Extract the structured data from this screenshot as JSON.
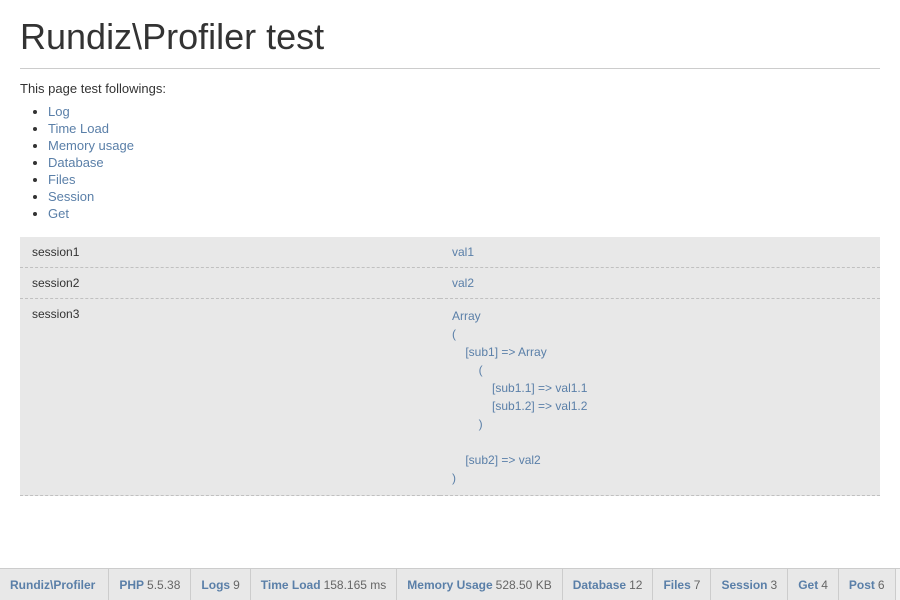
{
  "page": {
    "title": "Rundiz\\Profiler test",
    "intro": "This page test followings:"
  },
  "features": [
    {
      "label": "Log",
      "href": "#log"
    },
    {
      "label": "Time Load",
      "href": "#timeload"
    },
    {
      "label": "Memory usage",
      "href": "#memory"
    },
    {
      "label": "Database",
      "href": "#database"
    },
    {
      "label": "Files",
      "href": "#files"
    },
    {
      "label": "Session",
      "href": "#session"
    },
    {
      "label": "Get",
      "href": "#get"
    }
  ],
  "table_rows": [
    {
      "key": "session1",
      "value": "val1",
      "type": "simple"
    },
    {
      "key": "session2",
      "value": "val2",
      "type": "simple"
    },
    {
      "key": "session3",
      "value": "Array\n(\n    [sub1] => Array\n        (\n            [sub1.1] => val1.1\n            [sub1.2] => val1.2\n        )\n\n    [sub2] => val2\n)",
      "type": "array"
    }
  ],
  "bottom_bar": {
    "items": [
      {
        "label": "Rundiz\\Profiler",
        "value": "",
        "key": "profiler"
      },
      {
        "label": "PHP",
        "value": "5.5.38",
        "key": "php"
      },
      {
        "label": "Logs",
        "value": "9",
        "key": "logs"
      },
      {
        "label": "Time Load",
        "value": "158.165 ms",
        "key": "timeload"
      },
      {
        "label": "Memory Usage",
        "value": "528.50 KB",
        "key": "memory"
      },
      {
        "label": "Database",
        "value": "12",
        "key": "database"
      },
      {
        "label": "Files",
        "value": "7",
        "key": "files"
      },
      {
        "label": "Session",
        "value": "3",
        "key": "session"
      },
      {
        "label": "Get",
        "value": "4",
        "key": "get"
      },
      {
        "label": "Post",
        "value": "6",
        "key": "post"
      }
    ]
  }
}
